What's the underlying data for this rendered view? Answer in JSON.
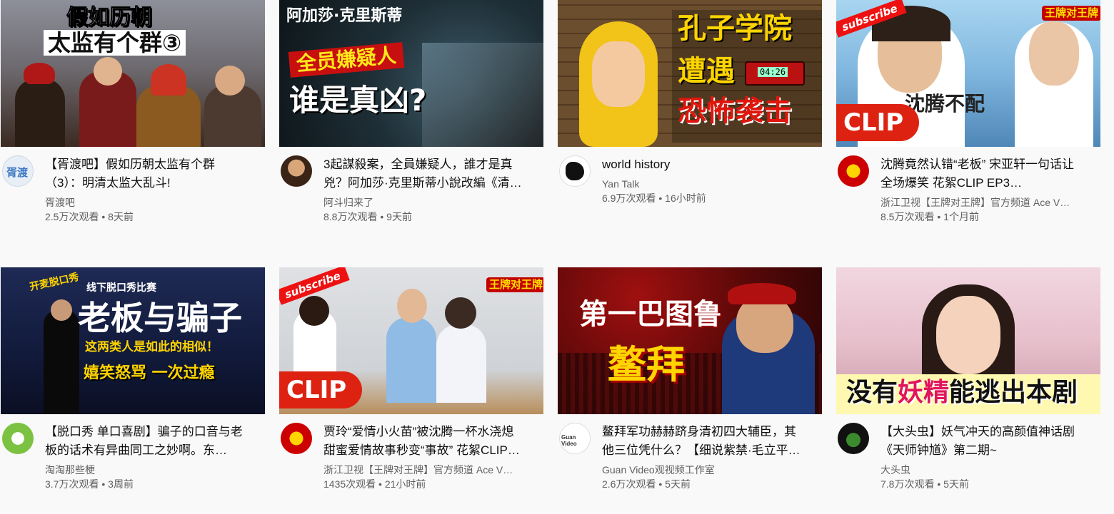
{
  "videos": [
    {
      "thumb_lines": [
        "假如历朝",
        "太监有个群③"
      ],
      "avatar_text": "胥渡",
      "title": "【胥渡吧】假如历朝太监有个群（3）：明清太监大乱斗!",
      "channel": "胥渡吧",
      "views": "2.5万次观看",
      "age": "8天前"
    },
    {
      "thumb_lines": [
        "阿加莎·克里斯蒂",
        "全员嫌疑人",
        "谁是真凶?"
      ],
      "title": "3起謀殺案，全員嫌疑人，誰才是真兇？阿加莎·克里斯蒂小說改編《清…",
      "channel": "阿斗归来了",
      "views": "8.8万次观看",
      "age": "9天前"
    },
    {
      "thumb_lines": [
        "孔子学院",
        "遭遇",
        "恐怖袭击"
      ],
      "thumb_timer": "04:26",
      "title": "world history",
      "channel": "Yan Talk",
      "views": "6.9万次观看",
      "age": "16小时前"
    },
    {
      "thumb_sub": "subscribe",
      "thumb_logo": "王牌对王牌",
      "thumb_caption": "沈腾不配",
      "thumb_clip": "CLIP",
      "title": "沈腾竟然认错“老板” 宋亚轩一句话让全场爆笑 花絮CLIP EP3…",
      "channel": "浙江卫视【王牌对王牌】官方频道 Ace V…",
      "views": "8.5万次观看",
      "age": "1个月前"
    },
    {
      "thumb_lines": [
        "线下脱口秀比赛",
        "老板与骗子",
        "这两类人是如此的相似！",
        "嬉笑怒骂  一次过瘾"
      ],
      "thumb_logo": "开麦脱口秀",
      "title": "【脱口秀 单口喜剧】骗子的口音与老板的话术有异曲同工之妙啊。东…",
      "channel": "淘淘那些梗",
      "views": "3.7万次观看",
      "age": "3周前"
    },
    {
      "thumb_sub": "subscribe",
      "thumb_logo": "王牌对王牌",
      "thumb_clip": "CLIP",
      "title": "贾玲“爱情小火苗”被沈腾一杯水浇熄 甜蜜爱情故事秒变“事故” 花絮CLIP…",
      "channel": "浙江卫视【王牌对王牌】官方频道 Ace V…",
      "views": "1435次观看",
      "age": "21小时前"
    },
    {
      "thumb_lines": [
        "第一巴图鲁",
        "鳌拜"
      ],
      "avatar_text": "Guan Video",
      "title": "鳌拜军功赫赫跻身清初四大辅臣，其他三位凭什么？【细说紫禁·毛立平…",
      "channel": "Guan Video观视频工作室",
      "views": "2.6万次观看",
      "age": "5天前"
    },
    {
      "thumb_lines": [
        "没有",
        "妖精",
        "能逃出本剧"
      ],
      "title": "【大头虫】妖气冲天的高颜值神话剧《天师钟馗》第二期~",
      "channel": "大头虫",
      "views": "7.8万次观看",
      "age": "5天前"
    }
  ],
  "stats_separator": " • ",
  "colors": {
    "text_primary": "#0f0f0f",
    "text_secondary": "#606060",
    "background": "#f9f9f9"
  }
}
